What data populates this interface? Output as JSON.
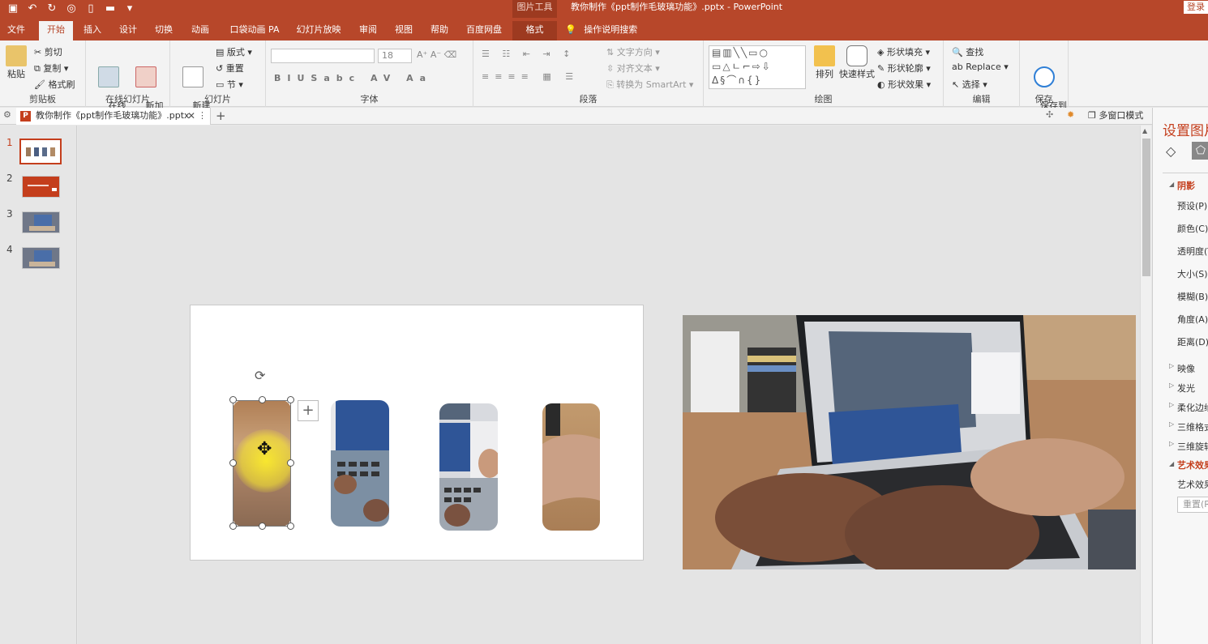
{
  "titlebar": {
    "tool_title": "图片工具",
    "document_title": "教你制作《ppt制作毛玻璃功能》.pptx - PowerPoint",
    "login": "登录"
  },
  "tabs": [
    "文件",
    "开始",
    "插入",
    "设计",
    "切换",
    "动画",
    "口袋动画 PA",
    "幻灯片放映",
    "审阅",
    "视图",
    "帮助",
    "百度网盘",
    "格式"
  ],
  "active_tab": "开始",
  "search_hint": "操作说明搜索",
  "ribbon": {
    "clipboard": {
      "paste": "粘贴",
      "cut": "剪切",
      "copy": "复制",
      "format_painter": "格式刷",
      "label": "剪贴板"
    },
    "online": {
      "online_slides": "在线\n幻灯片",
      "new_animation_page": "新加\n动画页",
      "label": "在线幻灯片"
    },
    "slides": {
      "new_slide": "新建\n幻灯片",
      "layout": "版式",
      "reset": "重置",
      "section": "节",
      "label": "幻灯片"
    },
    "font": {
      "size": "18",
      "label": "字体"
    },
    "paragraph": {
      "text_direction": "文字方向",
      "align_text": "对齐文本",
      "convert_smartart": "转换为 SmartArt",
      "label": "段落"
    },
    "drawing": {
      "arrange": "排列",
      "quick_styles": "快速样式",
      "shape_fill": "形状填充",
      "shape_outline": "形状轮廓",
      "shape_effects": "形状效果",
      "label": "绘图"
    },
    "editing": {
      "find": "查找",
      "replace": "Replace",
      "select": "选择",
      "label": "编辑"
    },
    "save": {
      "save_baidu": "保存到\n百度网盘",
      "label": "保存"
    }
  },
  "docbar": {
    "tab_title": "教你制作《ppt制作毛玻璃功能》.pptx",
    "multi_window": "多窗口模式"
  },
  "thumbnails": [
    "1",
    "2",
    "3",
    "4"
  ],
  "selected_slide": "1",
  "format_pane": {
    "title": "设置图片格式",
    "items": [
      {
        "label": "阴影",
        "type": "section"
      },
      {
        "label": "预设(P)",
        "type": "item"
      },
      {
        "label": "颜色(C)",
        "type": "item"
      },
      {
        "label": "透明度(T)",
        "type": "item"
      },
      {
        "label": "大小(S)",
        "type": "item"
      },
      {
        "label": "模糊(B)",
        "type": "item"
      },
      {
        "label": "角度(A)",
        "type": "item"
      },
      {
        "label": "距离(D)",
        "type": "item"
      },
      {
        "label": "映像",
        "type": "collapsed"
      },
      {
        "label": "发光",
        "type": "collapsed"
      },
      {
        "label": "柔化边缘",
        "type": "collapsed"
      },
      {
        "label": "三维格式",
        "type": "collapsed"
      },
      {
        "label": "三维旋转",
        "type": "collapsed"
      },
      {
        "label": "艺术效果",
        "type": "section"
      },
      {
        "label": "艺术效果",
        "type": "item"
      }
    ],
    "reset": "重置(R)"
  },
  "colors": {
    "accent": "#b7472a",
    "accent_dark": "#9d3a20",
    "selection": "#c43e1c"
  }
}
